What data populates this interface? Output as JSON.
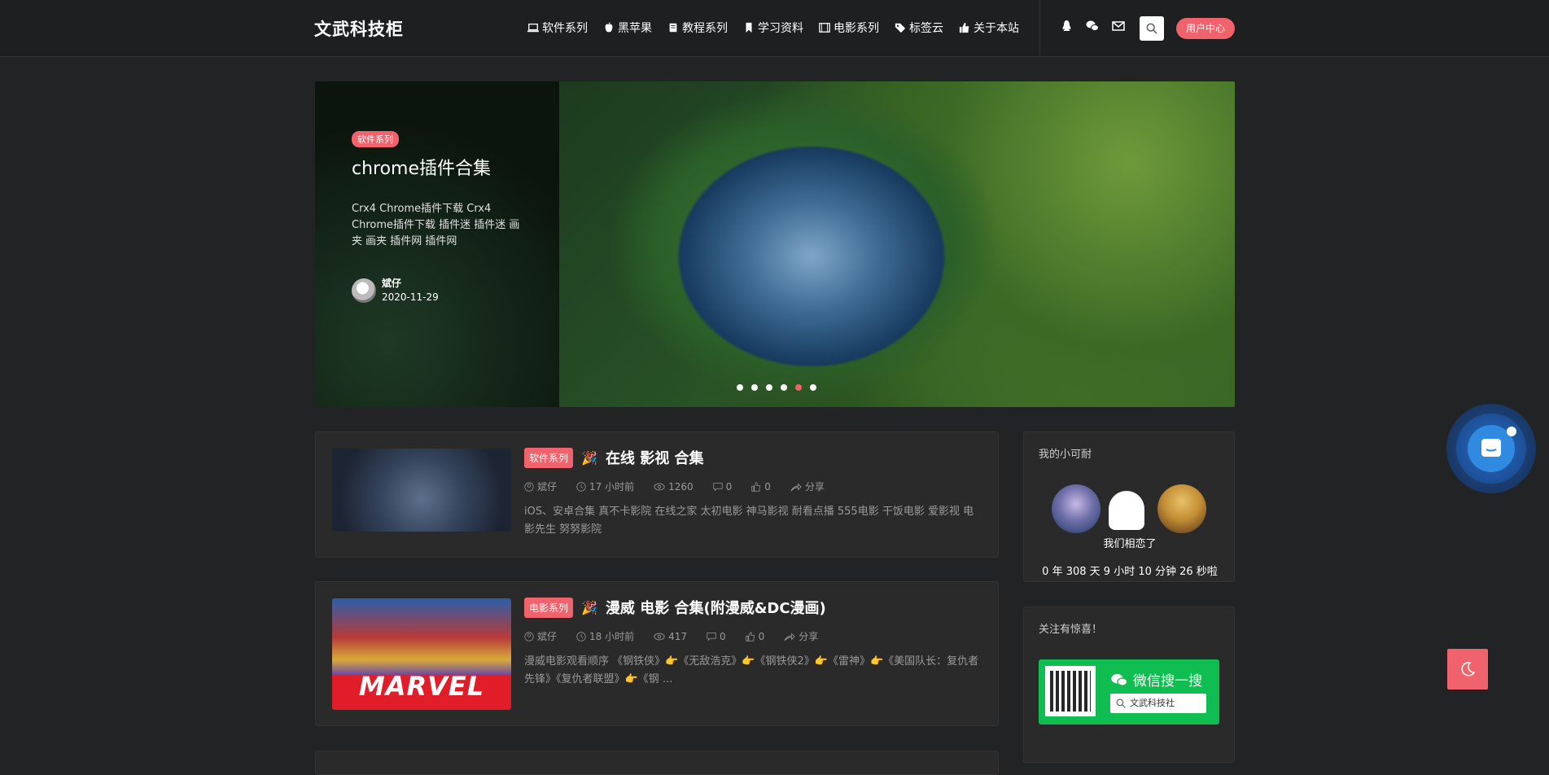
{
  "site": {
    "name": "文武科技柜"
  },
  "nav": [
    {
      "label": "软件系列",
      "icon": "laptop-icon"
    },
    {
      "label": "黑苹果",
      "icon": "apple-icon"
    },
    {
      "label": "教程系列",
      "icon": "book-icon"
    },
    {
      "label": "学习资料",
      "icon": "bookmark-icon"
    },
    {
      "label": "电影系列",
      "icon": "film-icon"
    },
    {
      "label": "标签云",
      "icon": "tags-icon"
    },
    {
      "label": "关于本站",
      "icon": "thumbs-up-icon"
    }
  ],
  "header": {
    "user_center": "用户中心"
  },
  "banner": {
    "category": "软件系列",
    "title": "chrome插件合集",
    "description": "Crx4 Chrome插件下载 Crx4 Chrome插件下载 插件迷 插件迷 画夹 画夹 插件网 插件网",
    "author": "斌仔",
    "date": "2020-11-29",
    "slide_count": 6,
    "active_slide": 5
  },
  "posts": [
    {
      "category": "软件系列",
      "emoji": "🎉",
      "title": "在线 影视 合集",
      "author": "斌仔",
      "time": "17 小时前",
      "views": "1260",
      "comments": "0",
      "likes": "0",
      "share": "分享",
      "excerpt": "iOS、安卓合集 真不卡影院 在线之家 太初电影 神马影视 耐看点播 555电影 干饭电影 爱影视 电影先生 努努影院"
    },
    {
      "category": "电影系列",
      "emoji": "🎉",
      "title": "漫威 电影 合集(附漫威&DC漫画)",
      "author": "斌仔",
      "time": "18 小时前",
      "views": "417",
      "comments": "0",
      "likes": "0",
      "share": "分享",
      "excerpt": "漫威电影观看顺序 《钢铁侠》👉《无敌浩克》👉《钢铁侠2》👉《雷神》👉《美国队长：复仇者先锋》《复仇者联盟》👉《钢 ...",
      "thumb_text": "MARVEL"
    }
  ],
  "widgets": {
    "couple": {
      "title": "我的小可耐",
      "label": "我们相恋了",
      "duration": "0 年 308 天 9 小时 10 分钟 26 秒啦"
    },
    "follow": {
      "title": "关注有惊喜！",
      "wechat_title": "微信搜一搜",
      "search_text": "文武科技社"
    }
  },
  "colors": {
    "accent": "#f0626c",
    "background": "#222324",
    "card": "#2a2a2b",
    "wechat": "#0fbd50",
    "chat": "#2f8ae0"
  }
}
